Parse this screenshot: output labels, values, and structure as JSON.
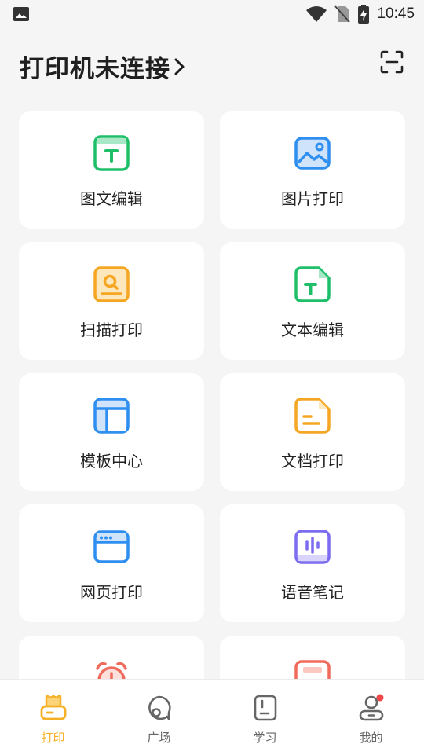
{
  "status_bar": {
    "time": "10:45",
    "icons": [
      "image-icon",
      "wifi-icon",
      "no-sim-icon",
      "battery-charging-icon"
    ]
  },
  "header": {
    "title": "打印机未连接",
    "title_icon": "chevron-right-icon",
    "action_icon": "scan-icon"
  },
  "features": [
    {
      "label": "图文编辑",
      "icon": "text-image-edit-icon",
      "color": "#1fbf6a"
    },
    {
      "label": "图片打印",
      "icon": "image-print-icon",
      "color": "#2f8ff0"
    },
    {
      "label": "扫描打印",
      "icon": "scan-print-icon",
      "color": "#f5a623"
    },
    {
      "label": "文本编辑",
      "icon": "text-document-icon",
      "color": "#1fbf6a"
    },
    {
      "label": "模板中心",
      "icon": "template-icon",
      "color": "#2f8ff0"
    },
    {
      "label": "文档打印",
      "icon": "document-print-icon",
      "color": "#f5a623"
    },
    {
      "label": "网页打印",
      "icon": "webpage-icon",
      "color": "#2f8ff0"
    },
    {
      "label": "语音笔记",
      "icon": "voice-note-icon",
      "color": "#7b6cf0"
    },
    {
      "label": "",
      "icon": "alarm-clock-icon",
      "color": "#f06b5b"
    },
    {
      "label": "",
      "icon": "red-card-icon",
      "color": "#f06b5b"
    }
  ],
  "bottom_nav": [
    {
      "label": "打印",
      "icon": "print-tab-icon",
      "active": true
    },
    {
      "label": "广场",
      "icon": "plaza-tab-icon",
      "active": false
    },
    {
      "label": "学习",
      "icon": "study-tab-icon",
      "active": false
    },
    {
      "label": "我的",
      "icon": "profile-tab-icon",
      "active": false,
      "badge": true
    }
  ],
  "colors": {
    "active": "#f5b025",
    "inactive": "#666666",
    "badge": "#f04848"
  }
}
